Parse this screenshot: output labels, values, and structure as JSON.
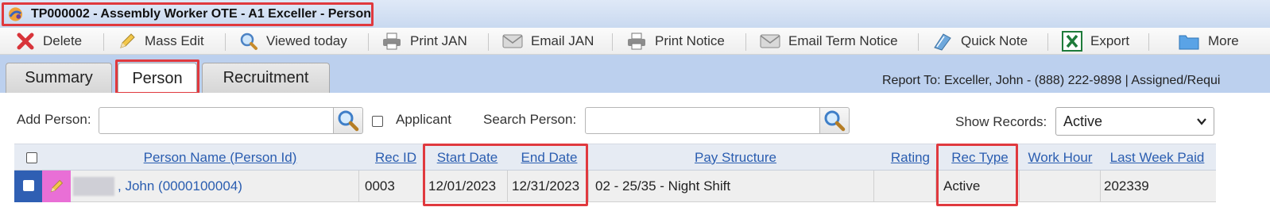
{
  "window": {
    "title": "TP000002 - Assembly Worker OTE - A1 Exceller - Person"
  },
  "toolbar": {
    "items": [
      {
        "label": "Delete",
        "icon": "delete-x-icon"
      },
      {
        "label": "Mass Edit",
        "icon": "pencil-icon"
      },
      {
        "label": "Viewed today",
        "icon": "magnifier-icon"
      },
      {
        "label": "Print JAN",
        "icon": "printer-icon"
      },
      {
        "label": "Email JAN",
        "icon": "envelope-icon"
      },
      {
        "label": "Print Notice",
        "icon": "printer-icon"
      },
      {
        "label": "Email Term Notice",
        "icon": "envelope-icon"
      },
      {
        "label": "Quick Note",
        "icon": "notebook-icon"
      },
      {
        "label": "Export",
        "icon": "excel-icon"
      },
      {
        "label": "More",
        "icon": "folder-icon"
      }
    ]
  },
  "tabs": [
    {
      "label": "Summary",
      "active": false
    },
    {
      "label": "Person",
      "active": true
    },
    {
      "label": "Recruitment",
      "active": false
    }
  ],
  "report_to": "Report To: Exceller, John - (888) 222-9898 | Assigned/Requi",
  "filters": {
    "add_person_label": "Add Person:",
    "add_person_value": "",
    "applicant_label": "Applicant",
    "applicant_checked": false,
    "search_person_label": "Search Person:",
    "search_person_value": "",
    "show_records_label": "Show Records:",
    "show_records_value": "Active"
  },
  "grid": {
    "columns": [
      "Person Name (Person Id)",
      "Rec ID",
      "Start Date",
      "End Date",
      "Pay Structure",
      "Rating",
      "Rec Type",
      "Work Hour",
      "Last Week Paid"
    ],
    "rows": [
      {
        "person_name": ", John (0000100004)",
        "rec_id": "0003",
        "start_date": "12/01/2023",
        "end_date": "12/31/2023",
        "pay_structure": "02 - 25/35 - Night Shift",
        "rating": "",
        "rec_type": "Active",
        "work_hour": "",
        "last_week_paid": "202339"
      }
    ]
  },
  "colors": {
    "highlight": "#e0393e",
    "tabbar": "#bcd0ee",
    "link": "#2a5db0",
    "row_selector": "#2f5fb3",
    "edit_cell": "#e96fd6"
  }
}
